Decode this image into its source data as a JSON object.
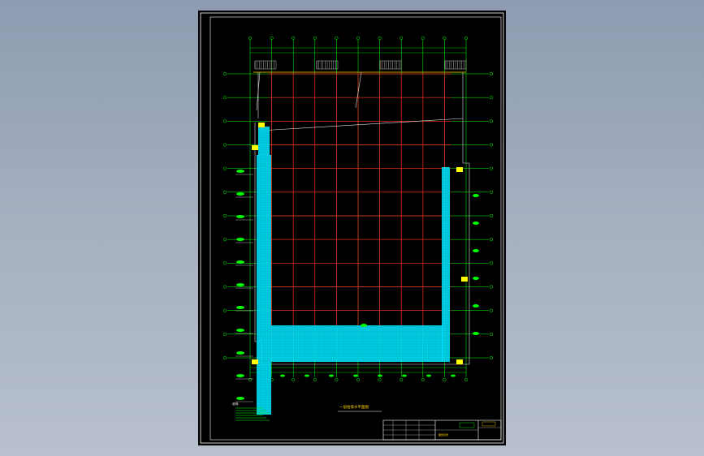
{
  "colors": {
    "background_gradient_top": "#8e9bb0",
    "background_gradient_bottom": "#b8c0cd",
    "sheet": "#000000",
    "frame": "#ffffff",
    "grid_axes": "#00ff00",
    "structure_grid": "#ff2020",
    "walls": "#e0e0e0",
    "zones": "#00e5ff",
    "columns": "#ffff00",
    "dimension_line": "#ffd400"
  },
  "drawing": {
    "title_label": "一层给排水平面图",
    "notes_heading": "说明:",
    "title_block_label": "图纸目录"
  },
  "grid": {
    "column_axis_count": 11,
    "row_axis_count": 13
  }
}
